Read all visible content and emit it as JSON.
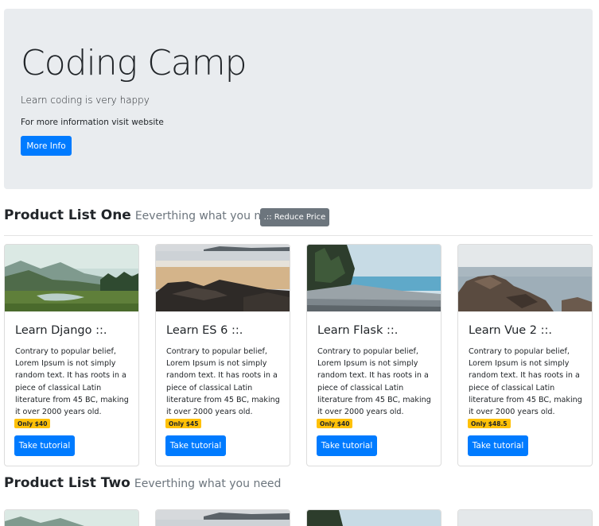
{
  "jumbotron": {
    "title": "Coding Camp",
    "lead": "Learn coding is very happy",
    "info": "For more information visit website",
    "button_label": "More Info"
  },
  "list_one": {
    "title": "Product List One",
    "subtitle": "Eeverthing what you need",
    "reduce_label": ".:: Reduce Price"
  },
  "list_two": {
    "title": "Product List Two",
    "subtitle": "Eeverthing what you need"
  },
  "products": [
    {
      "title": "Learn Django ::.",
      "text": "Contrary to popular belief, Lorem Ipsum is not simply random text. It has roots in a piece of classical Latin literature from 45 BC, making it over 2000 years old.",
      "price": "Only $40",
      "button": "Take tutorial"
    },
    {
      "title": "Learn ES 6 ::.",
      "text": "Contrary to popular belief, Lorem Ipsum is not simply random text. It has roots in a piece of classical Latin literature from 45 BC, making it over 2000 years old.",
      "price": "Only $45",
      "button": "Take tutorial"
    },
    {
      "title": "Learn Flask ::.",
      "text": "Contrary to popular belief, Lorem Ipsum is not simply random text. It has roots in a piece of classical Latin literature from 45 BC, making it over 2000 years old.",
      "price": "Only $40",
      "button": "Take tutorial"
    },
    {
      "title": "Learn Vue 2 ::.",
      "text": "Contrary to popular belief, Lorem Ipsum is not simply random text. It has roots in a piece of classical Latin literature from 45 BC, making it over 2000 years old.",
      "price": "Only $48.5",
      "button": "Take tutorial"
    }
  ],
  "colors": {
    "primary": "#007bff",
    "secondary": "#6c757d",
    "warning": "#ffc107",
    "jumbotron_bg": "#e9ecef"
  }
}
